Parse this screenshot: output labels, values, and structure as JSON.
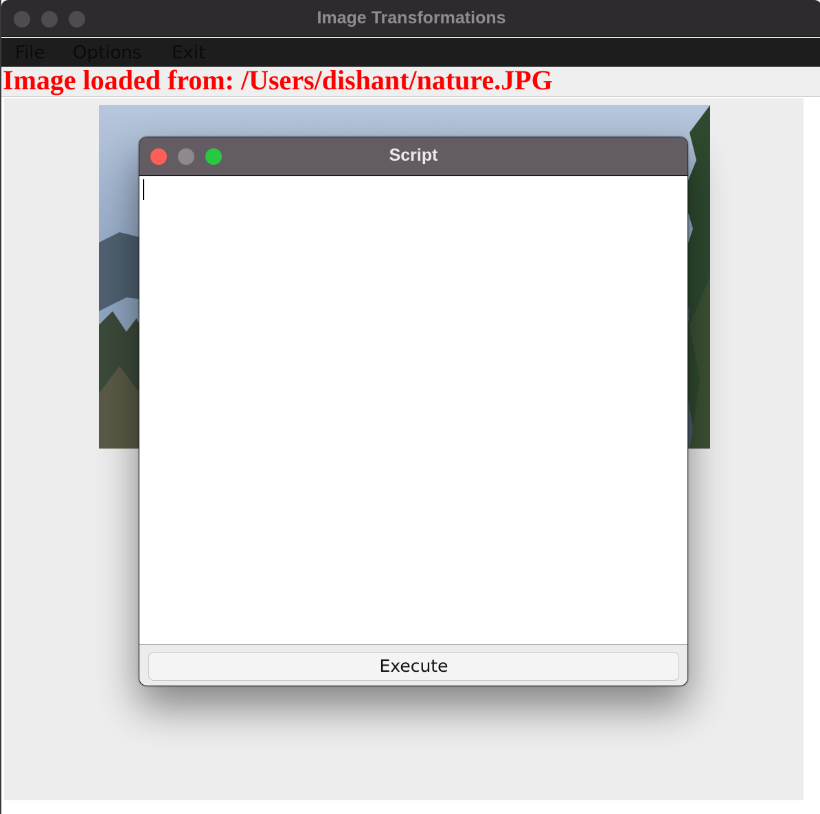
{
  "main_window": {
    "title": "Image Transformations",
    "menu": {
      "file": "File",
      "options": "Options",
      "exit": "Exit"
    },
    "status_text": "Image loaded from: /Users/dishant/nature.JPG"
  },
  "script_dialog": {
    "title": "Script",
    "text_value": "",
    "execute_label": "Execute"
  },
  "colors": {
    "status_text": "#ff0000",
    "close_button": "#ff5f57",
    "maximize_button": "#28c940"
  }
}
